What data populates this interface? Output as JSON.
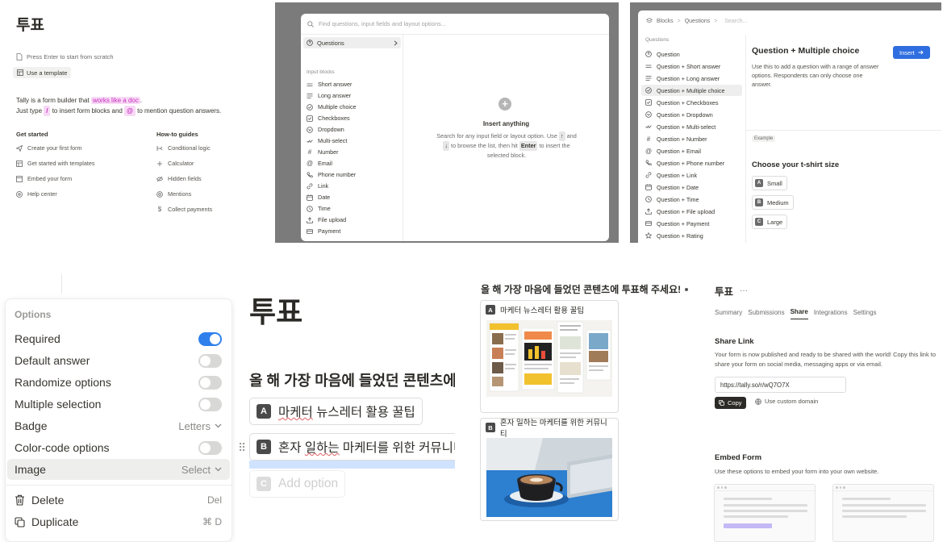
{
  "panel1": {
    "title": "투표",
    "hint": "Press Enter to start from scratch",
    "template_btn": "Use a template",
    "intro_1a": "Tally is a form builder that ",
    "intro_1b": "works like a doc",
    "intro_1c": ".",
    "intro_2a": "Just type ",
    "intro_2b": "/",
    "intro_2c": " to insert form blocks and ",
    "intro_2d": "@",
    "intro_2e": " to mention question answers.",
    "get_started_heading": "Get started",
    "get_started": [
      {
        "label": "Create your first form",
        "icon": "send-icon"
      },
      {
        "label": "Get started with templates",
        "icon": "template-icon"
      },
      {
        "label": "Embed your form",
        "icon": "embed-icon"
      },
      {
        "label": "Help center",
        "icon": "help-icon"
      }
    ],
    "howto_heading": "How-to guides",
    "howto": [
      {
        "label": "Conditional logic",
        "icon": "logic-icon"
      },
      {
        "label": "Calculator",
        "icon": "calculator-icon"
      },
      {
        "label": "Hidden fields",
        "icon": "hidden-icon"
      },
      {
        "label": "Mentions",
        "icon": "at-icon"
      },
      {
        "label": "Collect payments",
        "icon": "dollar-icon"
      }
    ]
  },
  "panel2": {
    "search_placeholder": "Find questions, input fields and layout options...",
    "questions_label": "Questions",
    "input_blocks_heading": "Input blocks",
    "items": [
      "Short answer",
      "Long answer",
      "Multiple choice",
      "Checkboxes",
      "Dropdown",
      "Multi-select",
      "Number",
      "Email",
      "Phone number",
      "Link",
      "Date",
      "Time",
      "File upload",
      "Payment"
    ],
    "insert_title": "Insert anything",
    "insert_desc_1": "Search for any input field or layout option. Use ",
    "key_up": "↑",
    "insert_desc_2": " and ",
    "key_down": "↓",
    "insert_desc_3": " to browse the list, then hit ",
    "key_enter": "Enter",
    "insert_desc_4": " to insert the selected block."
  },
  "panel3": {
    "crumb_1": "Blocks",
    "crumb_2": "Questions",
    "crumb_search": "Search...",
    "section": "Questions",
    "items": [
      "Question",
      "Question + Short answer",
      "Question + Long answer",
      "Question + Multiple choice",
      "Question + Checkboxes",
      "Question + Dropdown",
      "Question + Multi-select",
      "Question + Number",
      "Question + Email",
      "Question + Phone number",
      "Question + Link",
      "Question + Date",
      "Question + Time",
      "Question + File upload",
      "Question + Payment",
      "Question + Rating"
    ],
    "selected_index": 3,
    "detail_title": "Question + Multiple choice",
    "insert_label": "Insert",
    "detail_desc": "Use this to add a question with a range of answer options. Respondents can only choose one answer.",
    "example_tag": "Example",
    "example_question": "Choose your t-shirt size",
    "example_options": [
      {
        "letter": "A",
        "label": "Small"
      },
      {
        "letter": "B",
        "label": "Medium"
      },
      {
        "letter": "C",
        "label": "Large"
      }
    ]
  },
  "panel4": {
    "heading": "Options",
    "options": [
      {
        "label": "Required",
        "type": "toggle",
        "on": true
      },
      {
        "label": "Default answer",
        "type": "toggle",
        "on": false
      },
      {
        "label": "Randomize options",
        "type": "toggle",
        "on": false
      },
      {
        "label": "Multiple selection",
        "type": "toggle",
        "on": false
      },
      {
        "label": "Badge",
        "type": "select",
        "value": "Letters"
      },
      {
        "label": "Color-code options",
        "type": "toggle",
        "on": false
      },
      {
        "label": "Image",
        "type": "select",
        "value": "Select"
      }
    ],
    "delete_label": "Delete",
    "delete_shortcut": "Del",
    "duplicate_label": "Duplicate",
    "duplicate_shortcut": "⌘ D"
  },
  "panel5": {
    "title": "투표",
    "question": "올 해 가장 마음에 들었던 콘텐츠에",
    "option_a_letter": "A",
    "option_a_1": "마케터",
    "option_a_2": " 뉴스레터 활용 꿀팁",
    "option_b_letter": "B",
    "option_b_1": "혼자 ",
    "option_b_2": "일하는",
    "option_b_3": " 마케터를 위한 커뮤니티",
    "add_letter": "C",
    "add_option": "Add option"
  },
  "panel6": {
    "question": "올 해 가장 마음에 들었던 콘텐츠에 투표해 주세요!",
    "choices": [
      {
        "letter": "A",
        "label": "마케터 뉴스레터 활용 꿀팁"
      },
      {
        "letter": "B",
        "label": "혼자 일하는 마케터를 위한 커뮤니티"
      }
    ]
  },
  "panel7": {
    "title": "투표",
    "more": "···",
    "tabs": [
      "Summary",
      "Submissions",
      "Share",
      "Integrations",
      "Settings"
    ],
    "active_tab": "Share",
    "share_heading": "Share Link",
    "share_desc": "Your form is now published and ready to be shared with the world! Copy this link to share your form on social media, messaging apps or via email.",
    "url": "https://tally.so/r/wQ7O7X",
    "copy_label": "Copy",
    "domain_label": "Use custom domain",
    "embed_heading": "Embed Form",
    "embed_desc": "Use these options to embed your form into your own website."
  },
  "colors": {
    "accent": "#2f80ed",
    "insert_button": "#2f6ee0",
    "highlight": "#c92fc1",
    "highlight_bg": "#f7d9f5"
  }
}
